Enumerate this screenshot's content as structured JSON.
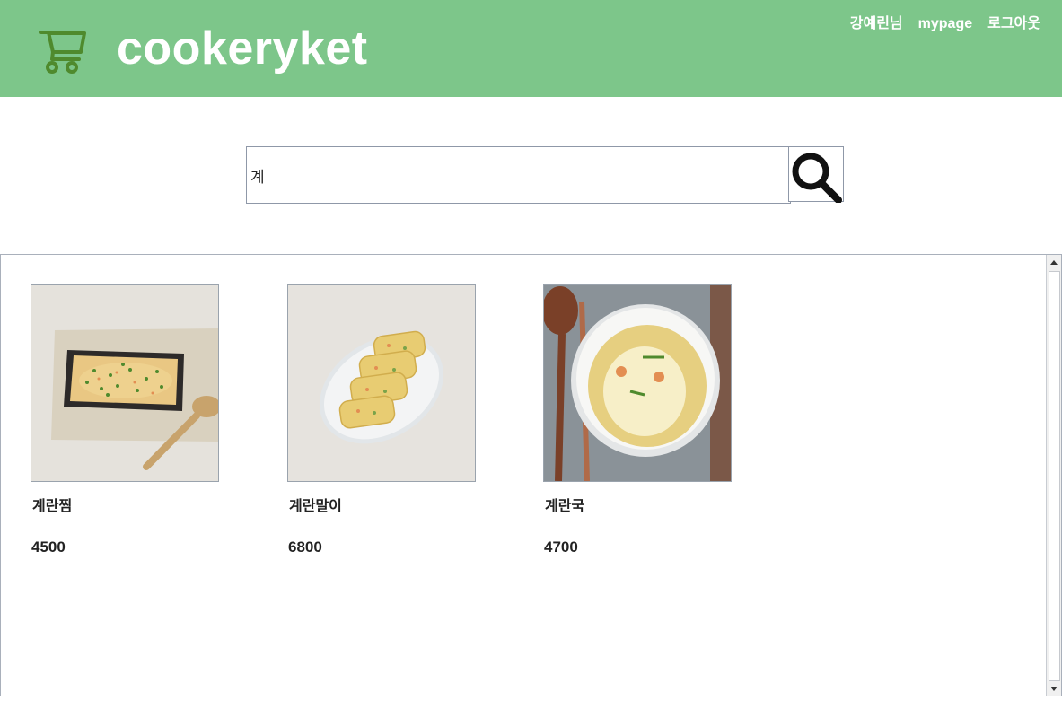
{
  "header": {
    "logo_text": "cookeryket",
    "cart_icon": "shopping-cart-icon",
    "background_color": "#7dc68a",
    "nav": {
      "user_name": "강예린님",
      "mypage": "mypage",
      "logout": "로그아웃"
    }
  },
  "search": {
    "value": "계",
    "button_icon": "magnifier-icon"
  },
  "results": [
    {
      "name": "계란찜",
      "price": "4500",
      "image": "steamed-egg-photo"
    },
    {
      "name": "계란말이",
      "price": "6800",
      "image": "rolled-omelette-photo"
    },
    {
      "name": "계란국",
      "price": "4700",
      "image": "egg-soup-photo"
    }
  ]
}
